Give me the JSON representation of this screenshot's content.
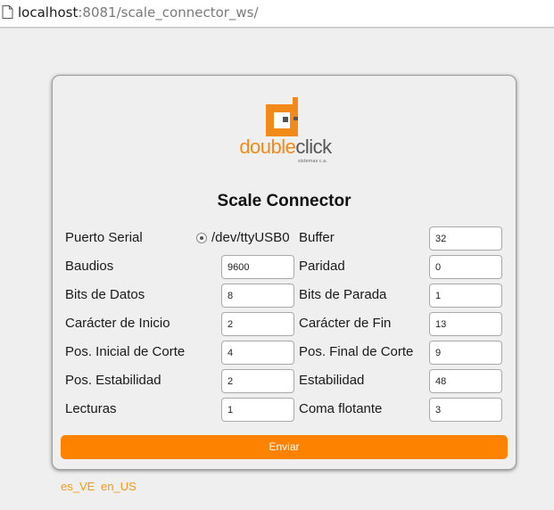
{
  "browser": {
    "url_host": "localhost",
    "url_rest": ":8081/scale_connector_ws/"
  },
  "brand": {
    "logo_double": "double",
    "logo_click": "click",
    "logo_tagline": "sistemas c.a.",
    "accent_color": "#fd8200"
  },
  "form": {
    "title": "Scale Connector",
    "left_column": [
      {
        "label": "Puerto Serial",
        "radio": {
          "label": "/dev/ttyUSB0",
          "selected": true
        }
      },
      {
        "label": "Baudios",
        "value": "9600"
      },
      {
        "label": "Bits de Datos",
        "value": "8"
      },
      {
        "label": "Carácter de Inicio",
        "value": "2"
      },
      {
        "label": "Pos. Inicial de Corte",
        "value": "4"
      },
      {
        "label": "Pos. Estabilidad",
        "value": "2"
      },
      {
        "label": "Lecturas",
        "value": "1"
      }
    ],
    "right_column": [
      {
        "label": "Buffer",
        "value": "32"
      },
      {
        "label": "Paridad",
        "value": "0"
      },
      {
        "label": "Bits de Parada",
        "value": "1"
      },
      {
        "label": "Carácter de Fin",
        "value": "13"
      },
      {
        "label": "Pos. Final de Corte",
        "value": "9"
      },
      {
        "label": "Estabilidad",
        "value": "48"
      },
      {
        "label": "Coma flotante",
        "value": "3"
      }
    ],
    "submit_label": "Enviar"
  },
  "languages": [
    "es_VE",
    "en_US"
  ]
}
